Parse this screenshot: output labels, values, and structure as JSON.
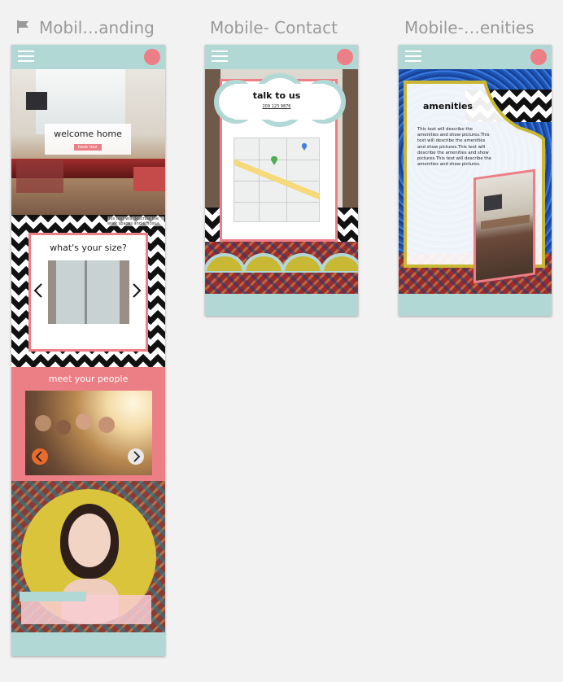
{
  "canvas": {
    "frames": [
      {
        "label": "Mobil…anding"
      },
      {
        "label": "Mobile- Contact"
      },
      {
        "label": "Mobile-…enities"
      }
    ]
  },
  "landing": {
    "hero_title": "welcome home",
    "hero_button": "book tour",
    "size_title": "what's your size?",
    "side_text": "this text will describe the work spaces and offices",
    "people_title": "meet your people"
  },
  "contact": {
    "title": "talk to us",
    "phone": "209 123 9876"
  },
  "amenities": {
    "title": "amenities",
    "body": "This text will describe the amenities and show pictures.This text will describe the amenities and show pictures.This text will describe the amenities and show pictures.This text will describe the amenities and show pictures."
  },
  "colors": {
    "teal": "#b2d8d6",
    "pink": "#ec7f85",
    "mustard": "#c9b833",
    "blue_texture": "#1f55b5"
  }
}
